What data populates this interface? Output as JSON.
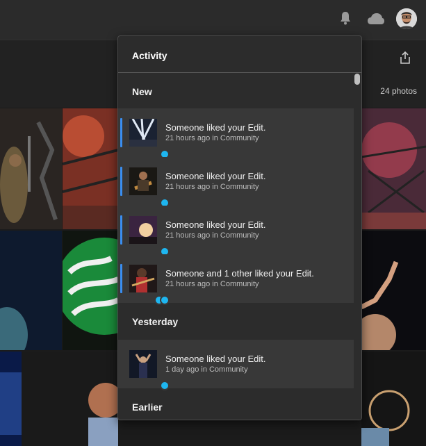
{
  "header": {
    "icons": [
      "bell-icon",
      "cloud-icon",
      "avatar"
    ]
  },
  "subbar": {
    "photo_count": "24 photos"
  },
  "activity": {
    "title": "Activity",
    "sections": [
      {
        "title": "New",
        "items": [
          {
            "text": "Someone liked your Edit.",
            "meta": "21 hours ago in Community"
          },
          {
            "text": "Someone liked your Edit.",
            "meta": "21 hours ago in Community"
          },
          {
            "text": "Someone liked your Edit.",
            "meta": "21 hours ago in Community"
          },
          {
            "text": "Someone and 1 other liked your Edit.",
            "meta": "21 hours ago in Community"
          }
        ]
      },
      {
        "title": "Yesterday",
        "items": [
          {
            "text": "Someone liked your Edit.",
            "meta": "1 day ago in Community"
          }
        ]
      },
      {
        "title": "Earlier",
        "items": []
      }
    ]
  },
  "colors": {
    "accent": "#3a8ef0",
    "badge": "#1eb6f0",
    "panel_bg": "#2c2c2c",
    "item_bg": "#383838"
  }
}
